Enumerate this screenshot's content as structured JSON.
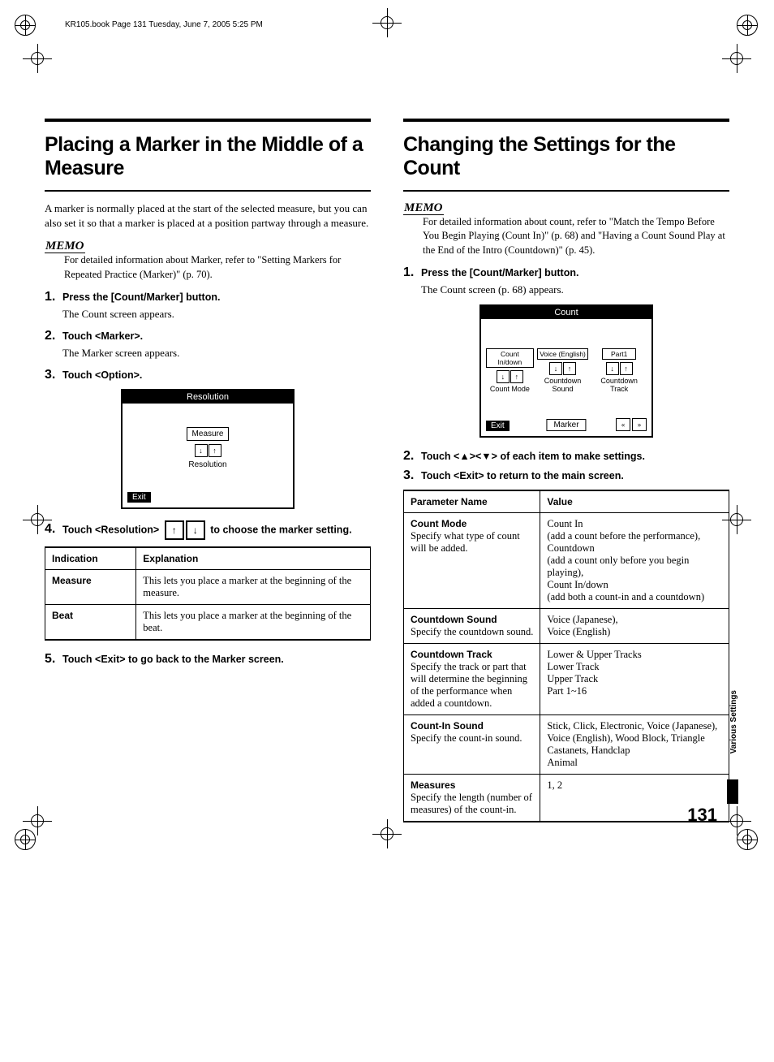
{
  "header": "KR105.book  Page 131  Tuesday, June 7, 2005  5:25 PM",
  "pageNumber": "131",
  "sideTab": "Various Settings",
  "left": {
    "title": "Placing a Marker in the Middle of a Measure",
    "intro": "A marker is normally placed at the start of the selected measure, but you can also set it so that a marker is placed at a position partway through a measure.",
    "memoLabel": "MEMO",
    "memo": "For detailed information about Marker, refer to \"Setting Markers for Repeated Practice (Marker)\" (p. 70).",
    "steps": {
      "s1": "Press the [Count/Marker] button.",
      "s1r": "The Count screen appears.",
      "s2": "Touch <Marker>.",
      "s2r": "The Marker screen appears.",
      "s3": "Touch <Option>.",
      "s4a": "Touch <Resolution>",
      "s4b": "to choose the marker setting.",
      "s5": "Touch <Exit> to go back to the Marker screen."
    },
    "screen": {
      "title": "Resolution",
      "box": "Measure",
      "label": "Resolution",
      "exit": "Exit"
    },
    "table": {
      "h1": "Indication",
      "h2": "Explanation",
      "r1c1": "Measure",
      "r1c2": "This lets you place a marker at the beginning of the measure.",
      "r2c1": "Beat",
      "r2c2": "This lets you place a marker at the beginning of the beat."
    }
  },
  "right": {
    "title": "Changing the Settings for the Count",
    "memoLabel": "MEMO",
    "memo": "For detailed information about count, refer to \"Match the Tempo Before You Begin Playing (Count In)\" (p. 68) and \"Having a Count Sound Play at the End of the Intro (Countdown)\" (p. 45).",
    "steps": {
      "s1": "Press the [Count/Marker] button.",
      "s1r": "The Count screen (p. 68) appears.",
      "s2": "Touch <▲><▼> of each item to make settings.",
      "s3": "Touch <Exit> to return to the main screen."
    },
    "screen": {
      "title": "Count",
      "col1box": "Count In/down",
      "col1label": "Count Mode",
      "col2box": "Voice (English)",
      "col2label": "Countdown Sound",
      "col3box": "Part1",
      "col3label": "Countdown Track",
      "exit": "Exit",
      "marker": "Marker"
    },
    "table": {
      "h1": "Parameter Name",
      "h2": "Value",
      "r1name": "Count Mode",
      "r1desc": "Specify what type of count will be added.",
      "r1val": "Count In\n(add a count before the performance),\nCountdown\n(add a count only before you begin playing),\nCount In/down\n(add both a count-in and a countdown)",
      "r2name": "Countdown Sound",
      "r2desc": "Specify the countdown sound.",
      "r2val": "Voice (Japanese),\nVoice (English)",
      "r3name": "Countdown Track",
      "r3desc": "Specify the track or part that will determine the beginning of the performance when added a countdown.",
      "r3val": "Lower & Upper Tracks\nLower Track\nUpper Track\nPart 1~16",
      "r4name": "Count-In Sound",
      "r4desc": "Specify the count-in sound.",
      "r4val": "Stick, Click, Electronic, Voice (Japanese), Voice (English), Wood Block, Triangle Castanets, Handclap\nAnimal",
      "r5name": "Measures",
      "r5desc": "Specify the length (number of measures) of the count-in.",
      "r5val": "1, 2"
    }
  }
}
